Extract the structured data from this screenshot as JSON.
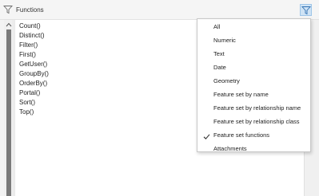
{
  "header": {
    "title": "Functions",
    "filter_icon": "filter-icon",
    "filter_button_icon": "filter-icon",
    "accent_color": "#cfe3f5"
  },
  "functions": [
    "Count()",
    "Distinct()",
    "Filter()",
    "First()",
    "GetUser()",
    "GroupBy()",
    "OrderBy()",
    "Portal()",
    "Sort()",
    "Top()"
  ],
  "filter_menu": {
    "items": [
      {
        "label": "All",
        "checked": false
      },
      {
        "label": "Numeric",
        "checked": false
      },
      {
        "label": "Text",
        "checked": false
      },
      {
        "label": "Date",
        "checked": false
      },
      {
        "label": "Geometry",
        "checked": false
      },
      {
        "label": "Feature set by name",
        "checked": false
      },
      {
        "label": "Feature set by relationship name",
        "checked": false
      },
      {
        "label": "Feature set by relationship class",
        "checked": false
      },
      {
        "label": "Feature set functions",
        "checked": true
      },
      {
        "label": "Attachments",
        "checked": false
      }
    ],
    "check_icon": "checkmark-icon"
  }
}
